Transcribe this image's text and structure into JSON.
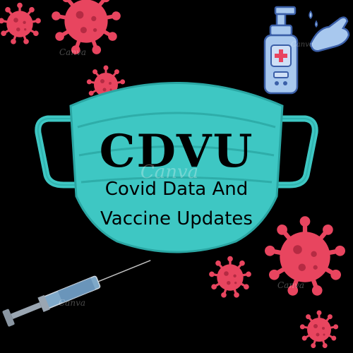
{
  "logo": {
    "title": "CDVU",
    "subtitle_line1": "Covid Data And",
    "subtitle_line2": "Vaccine Updates",
    "watermark": "Canva"
  },
  "icons": {
    "mask": "face-mask-icon",
    "virus": "virus-icon",
    "sanitizer": "hand-sanitizer-icon",
    "syringe": "syringe-icon"
  },
  "colors": {
    "background": "#000000",
    "mask_fill": "#3ec7c3",
    "mask_stroke": "#2aa6a3",
    "virus": "#e8455f",
    "virus_dark": "#b52b43",
    "sanitizer": "#a8c8ee",
    "sanitizer_outline": "#3b5fa8",
    "text": "#000000"
  }
}
